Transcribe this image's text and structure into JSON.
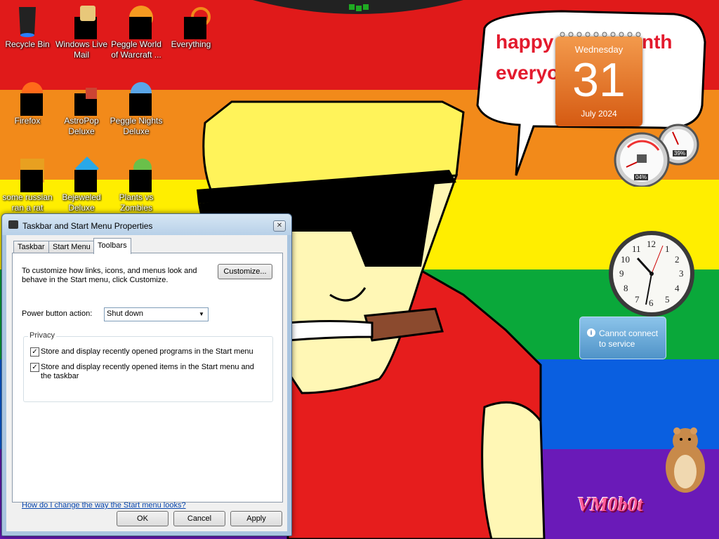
{
  "desktop": {
    "icons": [
      {
        "label": "Recycle Bin",
        "icon": "recycle-bin-icon"
      },
      {
        "label": "Windows Live Mail",
        "icon": "mail-icon"
      },
      {
        "label": "Peggle World of Warcraft ...",
        "icon": "peggle-icon"
      },
      {
        "label": "Everything",
        "icon": "search-icon"
      },
      {
        "label": "Firefox",
        "icon": "firefox-icon"
      },
      {
        "label": "AstroPop Deluxe",
        "icon": "astropop-icon"
      },
      {
        "label": "Peggle Nights Deluxe",
        "icon": "peggle-nights-icon"
      },
      {
        "label": "some russian ran a rat",
        "icon": "file-icon"
      },
      {
        "label": "Bejeweled Deluxe",
        "icon": "bejeweled-icon"
      },
      {
        "label": "Plants vs Zombies",
        "icon": "plants-vs-zombies-icon"
      }
    ],
    "speech_bubble": {
      "line1_a": "happy",
      "line1_b": "nth",
      "line2": "everyo"
    },
    "watermark": "VM0b0t",
    "colors": {
      "red": "#e01a1a",
      "orange": "#f28a1a",
      "yellow": "#ffee00",
      "green": "#0aa83a",
      "blue": "#0a5fe0",
      "purple": "#6a1ab8"
    }
  },
  "gadgets": {
    "calendar": {
      "weekday": "Wednesday",
      "day": "31",
      "month_year": "July 2024"
    },
    "cpu_meter": {
      "cpu": "04%",
      "memory": "39%"
    },
    "clock": {
      "numerals": [
        "12",
        "1",
        "2",
        "3",
        "4",
        "5",
        "6",
        "7",
        "8",
        "9",
        "10",
        "11"
      ]
    },
    "weather": {
      "message": "Cannot connect to service"
    }
  },
  "dialog": {
    "title": "Taskbar and Start Menu Properties",
    "tabs": [
      {
        "label": "Taskbar",
        "active": false
      },
      {
        "label": "Start Menu",
        "active": false
      },
      {
        "label": "Toolbars",
        "active": true
      }
    ],
    "intro_text": "To customize how links, icons, and menus look and behave in the Start menu, click Customize.",
    "customize_label": "Customize...",
    "power_label": "Power button action:",
    "power_value": "Shut down",
    "privacy_label": "Privacy",
    "checkbox1": {
      "label": "Store and display recently opened programs in the Start menu",
      "checked": true
    },
    "checkbox2": {
      "label": "Store and display recently opened items in the Start menu and the taskbar",
      "checked": true
    },
    "help_link": "How do I change the way the Start menu looks?",
    "buttons": {
      "ok": "OK",
      "cancel": "Cancel",
      "apply": "Apply"
    }
  }
}
